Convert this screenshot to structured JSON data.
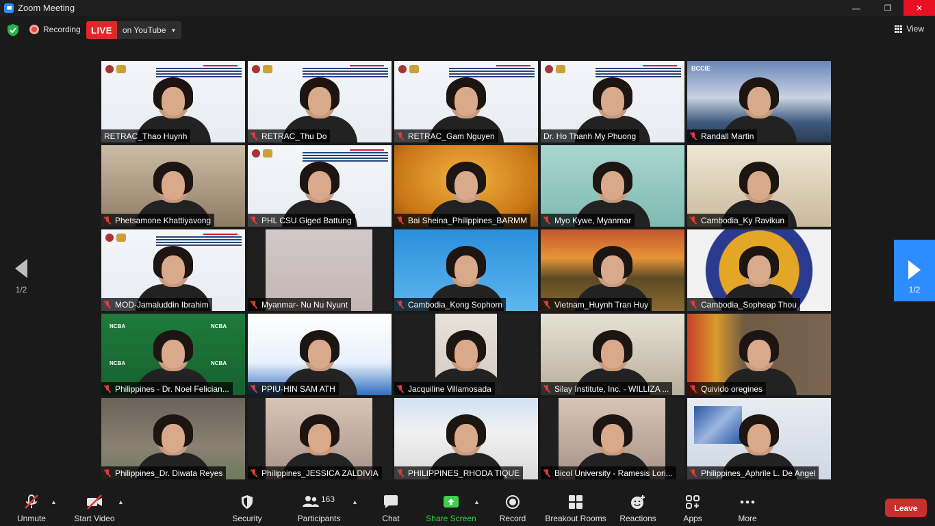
{
  "window": {
    "title": "Zoom Meeting",
    "controls": {
      "minimize": "—",
      "restore": "❐",
      "close": "✕"
    }
  },
  "topbar": {
    "recording_label": "Recording",
    "live_badge": "LIVE",
    "live_target": "on YouTube",
    "view_label": "View"
  },
  "pagination": {
    "left": "1/2",
    "right": "1/2"
  },
  "participants": [
    {
      "name": "RETRAC_Thao Huynh",
      "muted": false,
      "scene": "webinar",
      "active": true
    },
    {
      "name": "RETRAC_Thu Do",
      "muted": true,
      "scene": "webinar"
    },
    {
      "name": "RETRAC_Gam Nguyen",
      "muted": true,
      "scene": "webinar"
    },
    {
      "name": "Dr. Ho Thanh My Phuong",
      "muted": false,
      "scene": "webinar"
    },
    {
      "name": "Randall Martin",
      "muted": true,
      "scene": "mountain"
    },
    {
      "name": "Phetsamone Khattiyavong",
      "muted": true,
      "scene": "room"
    },
    {
      "name": "PHL CSU Giged Battung",
      "muted": true,
      "scene": "webinar"
    },
    {
      "name": "Bai Sheina_Philippines_BARMM",
      "muted": true,
      "scene": "orange"
    },
    {
      "name": "Myo Kywe, Myanmar",
      "muted": true,
      "scene": "teal"
    },
    {
      "name": "Cambodia_Ky Ravikun",
      "muted": true,
      "scene": "office"
    },
    {
      "name": "MOD-Jamaluddin Ibrahim",
      "muted": true,
      "scene": "webinar"
    },
    {
      "name": "Myanmar- Nu Nu Nyunt",
      "muted": true,
      "scene": "blank"
    },
    {
      "name": "Cambodia_Kong Sophorn",
      "muted": true,
      "scene": "blue"
    },
    {
      "name": "Vietnam_Huynh Tran Huy",
      "muted": true,
      "scene": "sunset"
    },
    {
      "name": "Cambodia_Sopheap Thou",
      "muted": true,
      "scene": "seal"
    },
    {
      "name": "Philippines - Dr. Noel Felician...",
      "muted": true,
      "scene": "green"
    },
    {
      "name": "PPIU-HIN SAM ATH",
      "muted": true,
      "scene": "poster"
    },
    {
      "name": "Jacquiline Villamosada",
      "muted": true,
      "scene": "dark"
    },
    {
      "name": "Silay Institute, Inc. - WILLIZA ...",
      "muted": true,
      "scene": "room2"
    },
    {
      "name": "Quivido oregines",
      "muted": true,
      "scene": "flags"
    },
    {
      "name": "Philippines_Dr. Diwata Reyes",
      "muted": true,
      "scene": "house"
    },
    {
      "name": "Philippines_JESSICA ZALDIVIA",
      "muted": true,
      "scene": "dim"
    },
    {
      "name": "PHILIPPINES_RHODA TIQUE",
      "muted": true,
      "scene": "building"
    },
    {
      "name": "Bicol University - Ramesis Lori...",
      "muted": true,
      "scene": "dim"
    },
    {
      "name": "Philippines_Aphrile L. De Angel",
      "muted": true,
      "scene": "art"
    }
  ],
  "tile_text": {
    "bccie": "BCCIE",
    "ncba": "NCBA"
  },
  "toolbar": {
    "unmute": "Unmute",
    "start_video": "Start Video",
    "security": "Security",
    "participants": "Participants",
    "participant_count": "163",
    "chat": "Chat",
    "share_screen": "Share Screen",
    "record": "Record",
    "breakout_rooms": "Breakout Rooms",
    "reactions": "Reactions",
    "apps": "Apps",
    "more": "More",
    "leave": "Leave"
  },
  "colors": {
    "accent": "#2d8cff",
    "live": "#e02828",
    "share": "#3ed14a",
    "leave": "#c8302b",
    "active_speaker": "#d6e66a"
  }
}
